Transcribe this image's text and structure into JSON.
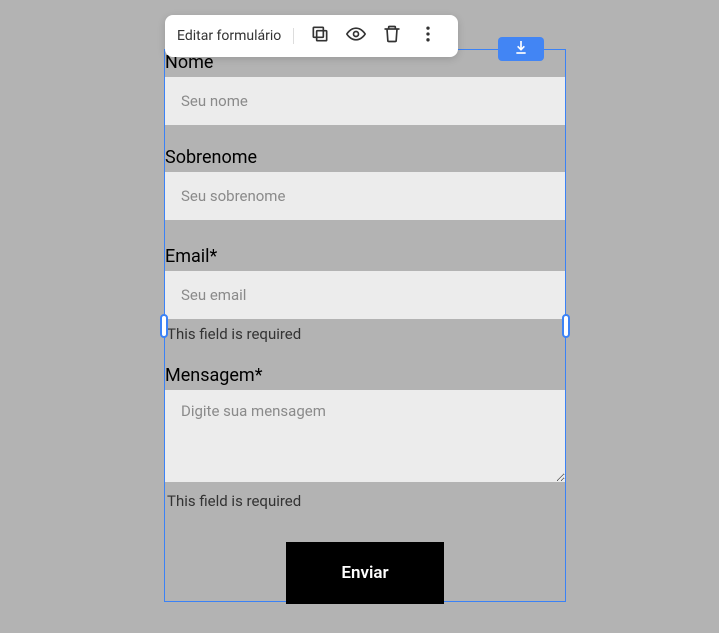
{
  "toolbar": {
    "label": "Editar formulário"
  },
  "form": {
    "fields": {
      "nome": {
        "label": "Nome",
        "placeholder": "Seu nome"
      },
      "sobrenome": {
        "label": "Sobrenome",
        "placeholder": "Seu sobrenome"
      },
      "email": {
        "label": "Email*",
        "placeholder": "Seu email",
        "error": "This field is required"
      },
      "mensagem": {
        "label": "Mensagem*",
        "placeholder": "Digite sua mensagem",
        "error": "This field is required"
      }
    },
    "submit_label": "Enviar"
  }
}
